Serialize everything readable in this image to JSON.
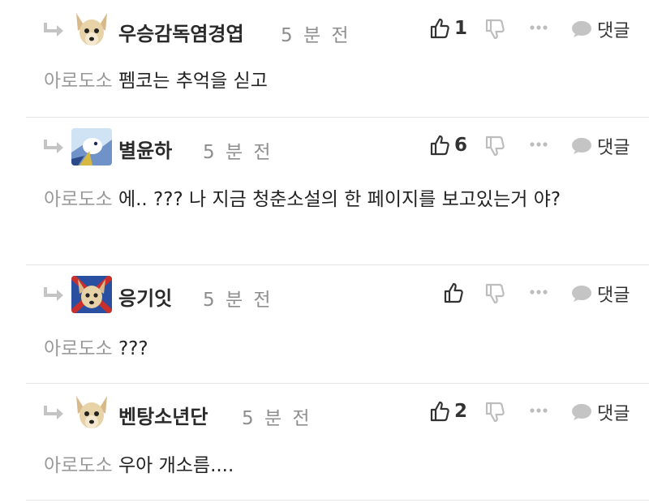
{
  "comments": [
    {
      "author": "우승감독염경엽",
      "time": "5 분 전",
      "likes": "1",
      "reply_label": "댓글",
      "mention": "아로도소",
      "text": "펨코는 추억을 싣고",
      "avatar": "dog-avatar"
    },
    {
      "author": "별윤하",
      "time": "5 분 전",
      "likes": "6",
      "reply_label": "댓글",
      "mention": "아로도소",
      "text": "에.. ??? 나 지금 청춘소설의 한 페이지를 보고있는거 야?",
      "avatar": "bird-avatar"
    },
    {
      "author": "응기잇",
      "time": "5 분 전",
      "likes": "",
      "reply_label": "댓글",
      "mention": "아로도소",
      "text": "???",
      "avatar": "dog-flag-avatar"
    },
    {
      "author": "벤탕소년단",
      "time": "5 분 전",
      "likes": "2",
      "reply_label": "댓글",
      "mention": "아로도소",
      "text": "우아 개소름....",
      "avatar": "dog-avatar"
    }
  ],
  "colors": {
    "meta_gray": "#8e8e8e",
    "mention_gray": "#9a9a9a",
    "icon_gray": "#bdbdbd",
    "divider": "#e6e6e6",
    "text": "#222222"
  },
  "icons": {
    "reply_arrow": "reply-arrow-icon",
    "like": "thumbs-up-icon",
    "dislike": "thumbs-down-icon",
    "more": "more-icon",
    "reply": "speech-bubble-icon"
  }
}
